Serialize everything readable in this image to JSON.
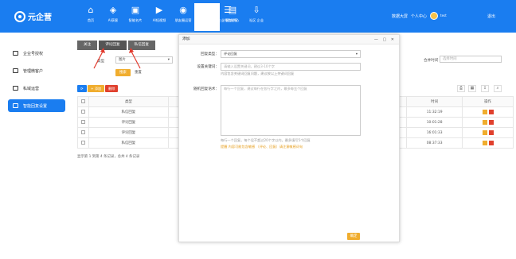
{
  "app": {
    "logo_text": "元企营",
    "nav": [
      {
        "label": "首页",
        "icon": "home-icon"
      },
      {
        "label": "AI获客",
        "icon": "cube-icon"
      },
      {
        "label": "智能名片",
        "icon": "card-icon"
      },
      {
        "label": "AI短视频",
        "icon": "video-icon"
      },
      {
        "label": "朋友圈运营",
        "icon": "target-icon"
      },
      {
        "label": "客户管理",
        "icon": "org-icon"
      },
      {
        "label": "企业微信运营",
        "icon": "chat-icon"
      },
      {
        "label": "营销中心",
        "icon": "window-icon"
      },
      {
        "label": "社区 企业",
        "icon": "download-icon"
      }
    ],
    "top_right": {
      "brand_link": "数据大屏",
      "personal_center": "个人中心",
      "username": "test",
      "logout": "退出"
    }
  },
  "sidebar": {
    "items": [
      {
        "label": "企业号授权",
        "icon": "account-icon"
      },
      {
        "label": "管理微客户",
        "icon": "customer-icon"
      },
      {
        "label": "私域运营",
        "icon": "private-icon"
      },
      {
        "label": "智能回复设置",
        "icon": "reply-icon"
      }
    ]
  },
  "main": {
    "tabs": [
      "关注",
      "评论回复",
      "私信回复"
    ],
    "filter_label": "类型",
    "filter_value": "图片",
    "search_btn": "搜索",
    "reset_btn": "重置",
    "right_filter_label": "合并时间",
    "right_filter_placeholder": "选择时间",
    "toolbar": {
      "refresh": "刷新",
      "add": "+ 添加",
      "delete": "删除"
    },
    "table": {
      "headers": [
        "",
        "类型",
        "",
        "时间",
        "操作"
      ],
      "rows": [
        {
          "type": "私信回复",
          "time": "11:32:19"
        },
        {
          "type": "评论回复",
          "time": "10:01:28"
        },
        {
          "type": "评论回复",
          "time": "16:01:33"
        },
        {
          "type": "私信回复",
          "time": "08:37:33"
        }
      ]
    },
    "pager_text": "显示第 1 到第 4 条记录，总共 4 条记录"
  },
  "dialog": {
    "title": "添加",
    "controls": "— ▢ ✕",
    "reply_type_label": "回复类型：",
    "reply_type_value": "评论回复",
    "keyword_label": "设置关键词：",
    "keyword_placeholder": "请输入设置关键词，建议3-10个字",
    "keyword_hint": "内容包含关键词回复问题，建议按以上关键词回复",
    "content_label": "随机回复语术：",
    "content_placeholder": "每行一个回复，建议每行在各行字之内，最多每五个回复",
    "content_hint": "每行一个回复，每个设不超过20个字以内，最多填写5个回复",
    "content_hint2": "提醒 内容可能包含敏感 （评论、回复）请注意敏感词句",
    "confirm": "确定"
  },
  "colors": {
    "brand_blue": "#1a7df0",
    "orange": "#f0ad2e",
    "danger": "#e0402d"
  }
}
